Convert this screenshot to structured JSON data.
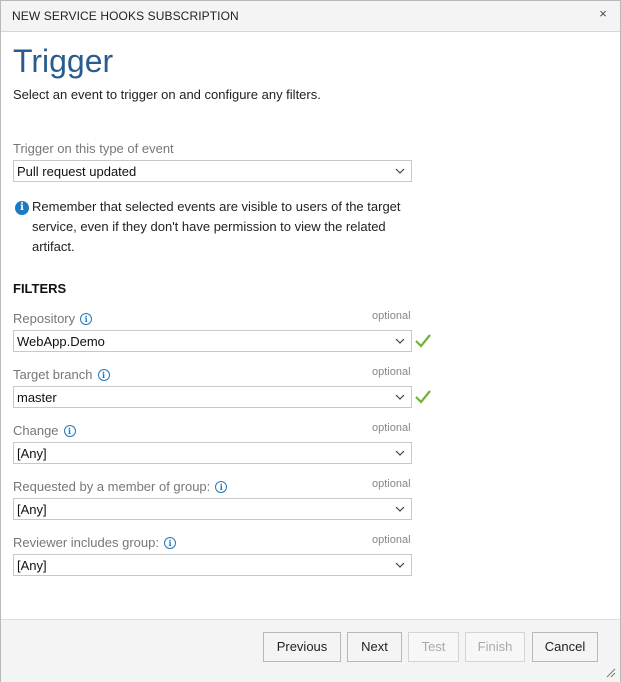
{
  "dialog": {
    "title": "NEW SERVICE HOOKS SUBSCRIPTION",
    "close_glyph": "×"
  },
  "header": {
    "heading": "Trigger",
    "subtitle": "Select an event to trigger on and configure any filters."
  },
  "event": {
    "label": "Trigger on this type of event",
    "value": "Pull request updated"
  },
  "notice": {
    "icon": "info-icon",
    "text": "Remember that selected events are visible to users of the target service, even if they don't have permission to view the related artifact."
  },
  "filters": {
    "heading": "FILTERS",
    "items": [
      {
        "label": "Repository",
        "optional": "optional",
        "value": "WebApp.Demo",
        "valid": true
      },
      {
        "label": "Target branch",
        "optional": "optional",
        "value": "master",
        "valid": true
      },
      {
        "label": "Change",
        "optional": "optional",
        "value": "[Any]",
        "valid": false
      },
      {
        "label": "Requested by a member of group:",
        "optional": "optional",
        "value": "[Any]",
        "valid": false
      },
      {
        "label": "Reviewer includes group:",
        "optional": "optional",
        "value": "[Any]",
        "valid": false
      }
    ]
  },
  "footer": {
    "previous": "Previous",
    "next": "Next",
    "test": "Test",
    "finish": "Finish",
    "cancel": "Cancel"
  },
  "colors": {
    "heading": "#2a5d8f",
    "info": "#1e7ac0",
    "check": "#6fb33b"
  }
}
